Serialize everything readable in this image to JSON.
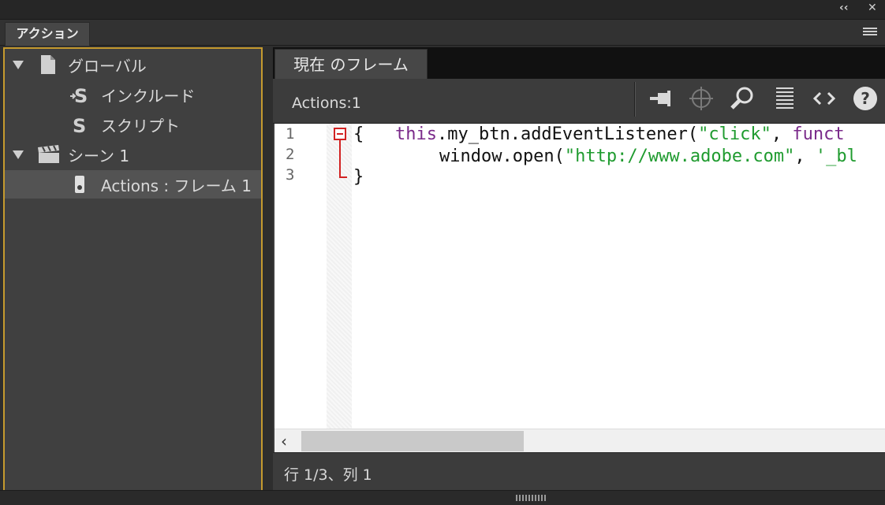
{
  "panel": {
    "tab_label": "アクション",
    "collapse_icon": "double-chevron-left-icon",
    "close_icon": "close-icon",
    "menu_icon": "panel-menu-icon"
  },
  "tree": {
    "items": [
      {
        "label": "グローバル",
        "icon": "document-icon",
        "expanded": true
      },
      {
        "label": "インクルード",
        "icon": "include-script-icon"
      },
      {
        "label": "スクリプト",
        "icon": "script-icon"
      },
      {
        "label": "シーン 1",
        "icon": "clapperboard-icon",
        "expanded": true
      },
      {
        "label": "Actions : フレーム 1",
        "icon": "frame-icon",
        "selected": true
      }
    ]
  },
  "editor": {
    "frame_tab": "現在 のフレーム",
    "scope_label": "Actions:1",
    "toolbar": [
      "pin-icon",
      "target-icon",
      "search-icon",
      "format-icon",
      "code-snippet-icon",
      "help-icon"
    ],
    "line_numbers": [
      "1",
      "2",
      "3"
    ],
    "code": {
      "l1_brace": "{",
      "l1_kw": "this",
      "l1_mid": ".my_btn.addEventListener(",
      "l1_str": "\"click\"",
      "l1_comma": ", ",
      "l1_kw2": "funct",
      "l2_pre": "    window.open(",
      "l2_str": "\"http://www.adobe.com\"",
      "l2_comma": ", ",
      "l2_str2": "'_bl",
      "l3_brace": "}"
    }
  },
  "status": {
    "text": "行 1/3、列 1"
  },
  "colors": {
    "accent_border": "#c59a2e",
    "keyword": "#7a2a8a",
    "string": "#1f9b2f",
    "fold_marker": "#d22222"
  }
}
